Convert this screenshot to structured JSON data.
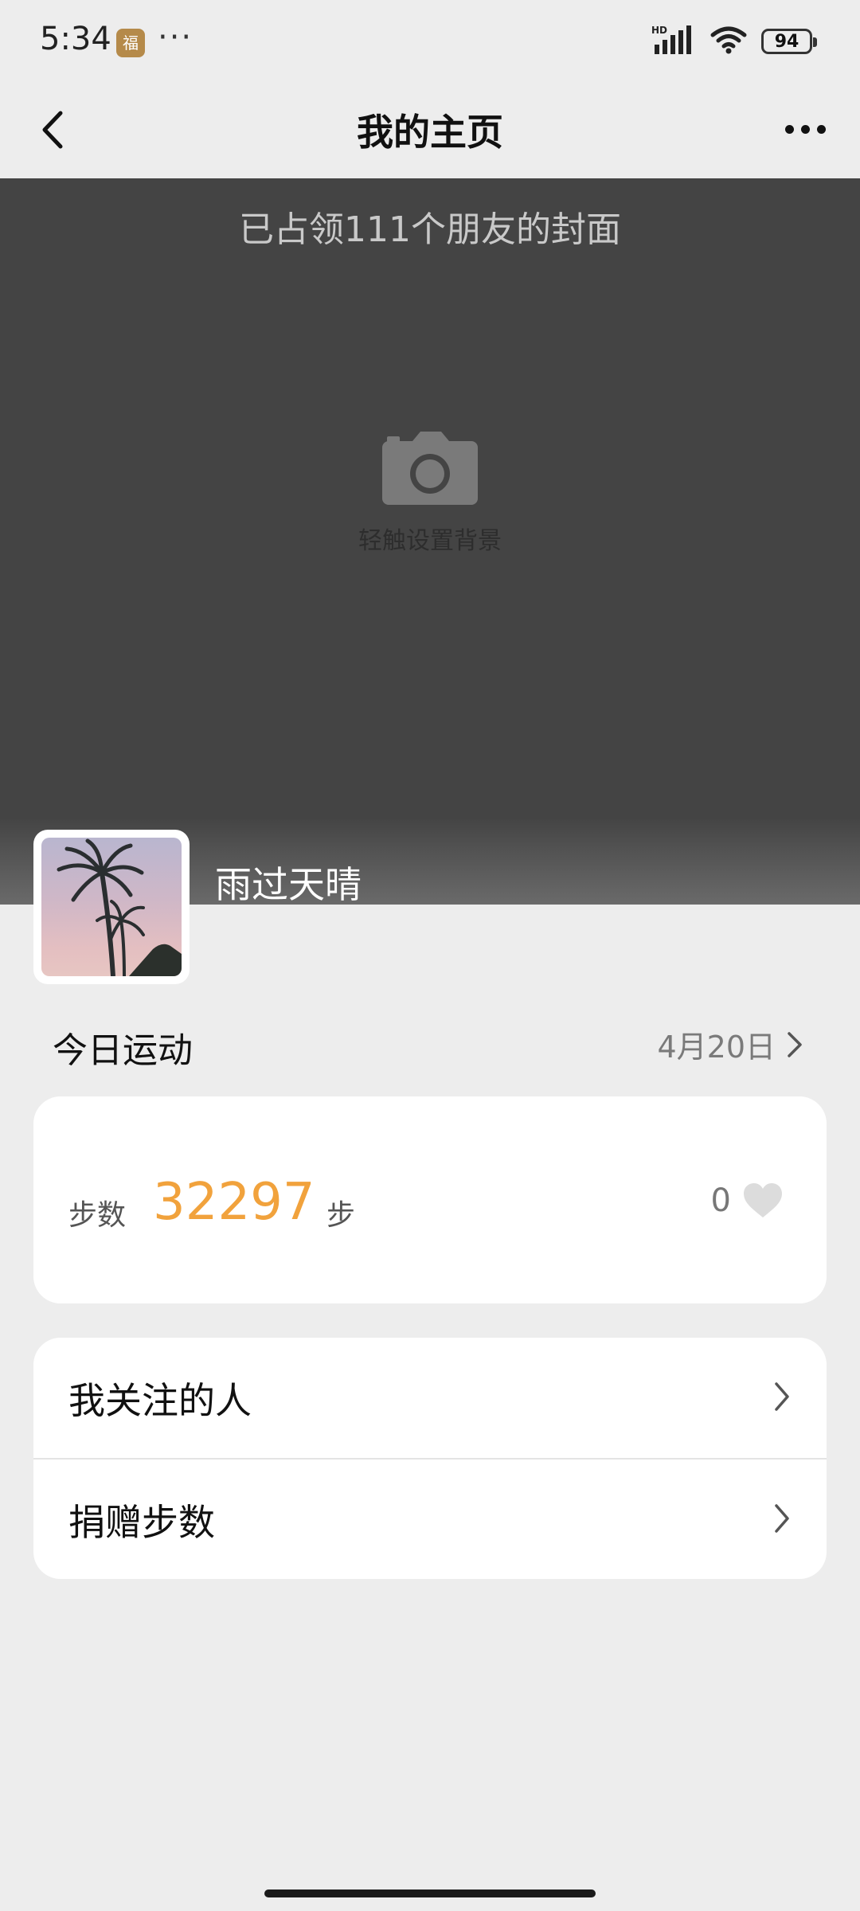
{
  "status_bar": {
    "time": "5:34",
    "app_badge": "福",
    "dots": "···",
    "network": "HD",
    "battery": "94"
  },
  "nav": {
    "title": "我的主页",
    "back_icon": "chevron-left-icon",
    "more_icon": "more-icon"
  },
  "cover": {
    "caption": "已占领111个朋友的封面",
    "hint": "轻触设置背景",
    "icon": "camera-icon"
  },
  "profile": {
    "username": "雨过天晴"
  },
  "today": {
    "title": "今日运动",
    "date": "4月20日"
  },
  "steps": {
    "label": "步数",
    "value": "32297",
    "unit": "步",
    "likes": "0",
    "like_icon": "heart-icon"
  },
  "menu": {
    "items": [
      {
        "label": "我关注的人"
      },
      {
        "label": "捐赠步数"
      }
    ]
  },
  "colors": {
    "accent": "#f1a23c",
    "cover": "#444444",
    "background": "#ededed"
  }
}
